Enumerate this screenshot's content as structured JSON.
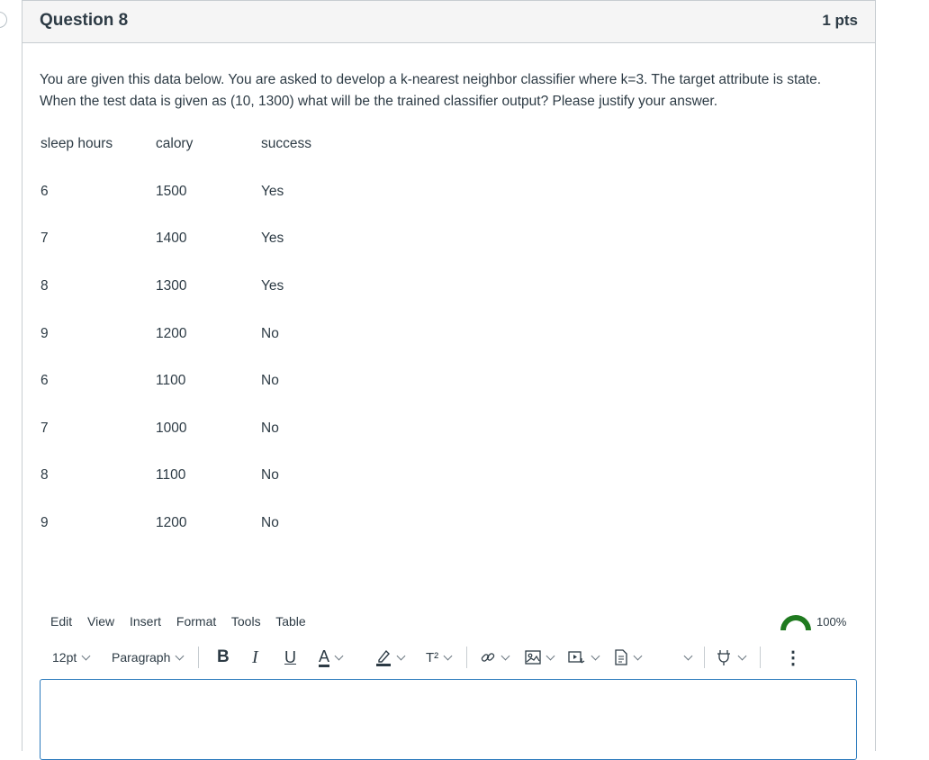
{
  "question": {
    "title": "Question 8",
    "points": "1 pts",
    "text_line1": "You are given this data below. You are asked to develop a k-nearest neighbor classifier where k=3. The target attribute is state.",
    "text_line2": "When the test data is given as (10, 1300) what will be the trained classifier output? Please justify your answer."
  },
  "table": {
    "headers": [
      "sleep hours",
      "calory",
      "success"
    ],
    "rows": [
      [
        "6",
        "1500",
        "Yes"
      ],
      [
        "7",
        "1400",
        "Yes"
      ],
      [
        "8",
        "1300",
        "Yes"
      ],
      [
        "9",
        "1200",
        "No"
      ],
      [
        "6",
        "1100",
        "No"
      ],
      [
        "7",
        "1000",
        "No"
      ],
      [
        "8",
        "1100",
        "No"
      ],
      [
        "9",
        "1200",
        "No"
      ]
    ]
  },
  "editor": {
    "menu": [
      "Edit",
      "View",
      "Insert",
      "Format",
      "Tools",
      "Table"
    ],
    "zoom": "100%",
    "font_size": "12pt",
    "block_format": "Paragraph",
    "bold": "B",
    "italic": "I",
    "underline": "U",
    "text_color": "A",
    "superscript": "T²",
    "more": "⋮",
    "value": ""
  },
  "colors": {
    "text": "#2d3b45",
    "border": "#c7cdd1",
    "header_bg": "#f5f5f5",
    "editor_focus": "#2b7abc",
    "gauge": "#1f7a1f"
  }
}
